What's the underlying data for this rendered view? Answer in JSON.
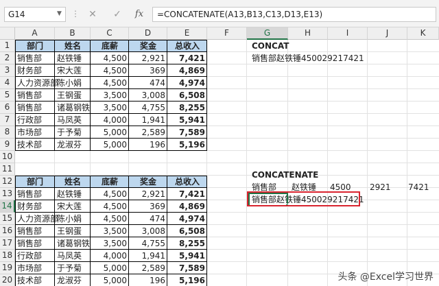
{
  "formula_bar": {
    "name_box": "G14",
    "dots": "⋮",
    "cancel": "✕",
    "enter": "✓",
    "fx": "fx",
    "formula": "=CONCATENATE(A13,B13,C13,D13,E13)"
  },
  "columns": [
    "A",
    "B",
    "C",
    "D",
    "E",
    "F",
    "G",
    "H",
    "I",
    "J",
    "K"
  ],
  "rows": [
    "1",
    "2",
    "3",
    "4",
    "5",
    "6",
    "7",
    "8",
    "9",
    "10",
    "11",
    "12",
    "13",
    "14",
    "15",
    "16",
    "17",
    "18",
    "19",
    "20"
  ],
  "table1": {
    "headers": [
      "部门",
      "姓名",
      "底薪",
      "奖金",
      "总收入"
    ],
    "rows": [
      [
        "销售部",
        "赵铁锤",
        "4,500",
        "2,921",
        "7,421"
      ],
      [
        "财务部",
        "宋大莲",
        "4,500",
        "369",
        "4,869"
      ],
      [
        "人力资源部",
        "陈小娟",
        "4,500",
        "474",
        "4,974"
      ],
      [
        "销售部",
        "王钢蛋",
        "3,500",
        "3,008",
        "6,508"
      ],
      [
        "销售部",
        "诸葛钢铁",
        "3,500",
        "4,755",
        "8,255"
      ],
      [
        "行政部",
        "马凤英",
        "4,000",
        "1,941",
        "5,941"
      ],
      [
        "市场部",
        "于予菊",
        "5,000",
        "2,589",
        "7,589"
      ],
      [
        "技术部",
        "龙淑芬",
        "5,000",
        "196",
        "5,196"
      ]
    ]
  },
  "table2": {
    "headers": [
      "部门",
      "姓名",
      "底薪",
      "奖金",
      "总收入"
    ],
    "rows": [
      [
        "销售部",
        "赵铁锤",
        "4,500",
        "2,921",
        "7,421"
      ],
      [
        "财务部",
        "宋大莲",
        "4,500",
        "369",
        "4,869"
      ],
      [
        "人力资源部",
        "陈小娟",
        "4,500",
        "474",
        "4,974"
      ],
      [
        "销售部",
        "王钢蛋",
        "3,500",
        "3,008",
        "6,508"
      ],
      [
        "销售部",
        "诸葛钢铁",
        "3,500",
        "4,755",
        "8,255"
      ],
      [
        "行政部",
        "马凤英",
        "4,000",
        "1,941",
        "5,941"
      ],
      [
        "市场部",
        "于予菊",
        "5,000",
        "2,589",
        "7,589"
      ],
      [
        "技术部",
        "龙淑芬",
        "5,000",
        "196",
        "5,196"
      ]
    ]
  },
  "side": {
    "concat_title": "CONCAT",
    "concat_result": "销售部赵铁锤450029217421",
    "concatenate_title": "CONCATENATE",
    "r13_g": "销售部",
    "r13_h": "赵铁锤",
    "r13_i": "4500",
    "r13_j": "2921",
    "r13_k": "7421",
    "concatenate_result": "销售部赵铁锤450029217421"
  },
  "watermark": "头条 @Excel学习世界",
  "colors": {
    "header_fill": "#bdd7ee",
    "highlight_box": "#d9232e",
    "active_cell": "#217346"
  }
}
